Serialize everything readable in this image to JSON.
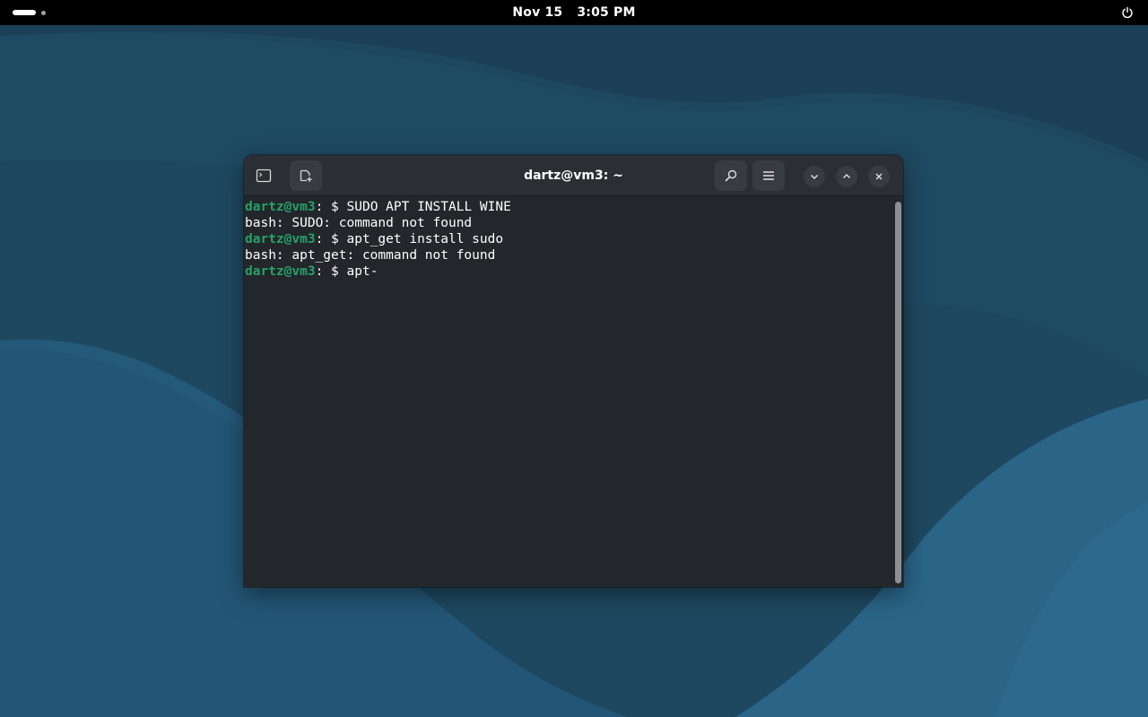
{
  "topbar": {
    "date": "Nov 15",
    "time": "3:05 PM",
    "activities_icon": "workspace-indicator-icon",
    "power_icon": "power-icon"
  },
  "window": {
    "title": "dartz@vm3: ~",
    "buttons": {
      "new_tab_icon": "terminal-tab-icon",
      "new_window_icon": "new-terminal-icon",
      "search_icon": "search-icon",
      "menu_icon": "hamburger-menu-icon",
      "minimize_icon": "chevron-down-icon",
      "maximize_icon": "chevron-up-icon",
      "close_icon": "close-icon"
    }
  },
  "terminal": {
    "prompt_user": "dartz@vm3",
    "prompt_suffix": ": $ ",
    "lines": [
      {
        "type": "prompt",
        "text": "SUDO APT INSTALL WINE"
      },
      {
        "type": "output",
        "text": "bash: SUDO: command not found"
      },
      {
        "type": "prompt",
        "text": "apt_get install sudo"
      },
      {
        "type": "output",
        "text": "bash: apt_get: command not found"
      },
      {
        "type": "prompt",
        "text": "apt-"
      }
    ]
  },
  "colors": {
    "prompt_user": "#26a269",
    "terminal_bg": "#23262b",
    "headerbar_bg": "#2b2e33",
    "desktop_bg": "#1f4a63"
  }
}
